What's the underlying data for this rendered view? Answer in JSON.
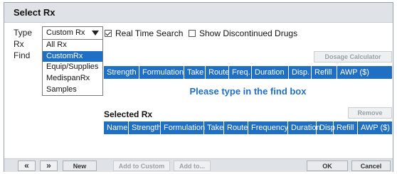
{
  "dialog": {
    "title": "Select Rx"
  },
  "labels": {
    "type": "Type",
    "rx": "Rx",
    "find": "Find"
  },
  "type_select": {
    "value": "Custom Rx",
    "options": [
      "All Rx",
      "CustomRx",
      "Equip/Supplies",
      "MedispanRx",
      "Samples"
    ],
    "highlighted_index": 1
  },
  "options": {
    "real_time_search": {
      "label": "Real Time Search",
      "checked": true
    },
    "show_discontinued": {
      "label": "Show Discontinued Drugs",
      "checked": false
    }
  },
  "buttons": {
    "dosage_calculator": "Dosage Calculator",
    "remove": "Remove",
    "prev": "«",
    "next": "»",
    "new": "New",
    "add_to_custom": "Add to Custom",
    "add_to": "Add to...",
    "ok": "OK",
    "cancel": "Cancel"
  },
  "results_table": {
    "columns": [
      "Strength",
      "Formulation",
      "Take",
      "Route",
      "Freq.",
      "Duration",
      "Disp.",
      "Refill",
      "AWP ($)"
    ],
    "empty_message": "Please type in the find box"
  },
  "selected_rx": {
    "title": "Selected Rx",
    "columns": [
      "Name",
      "Strength",
      "Formulation",
      "Take",
      "Route",
      "Frequency",
      "Duration",
      "Disp",
      "Refill",
      "AWP ($)"
    ]
  },
  "colors": {
    "accent": "#1f6fc5",
    "titlebar": "#dfe3e8"
  }
}
